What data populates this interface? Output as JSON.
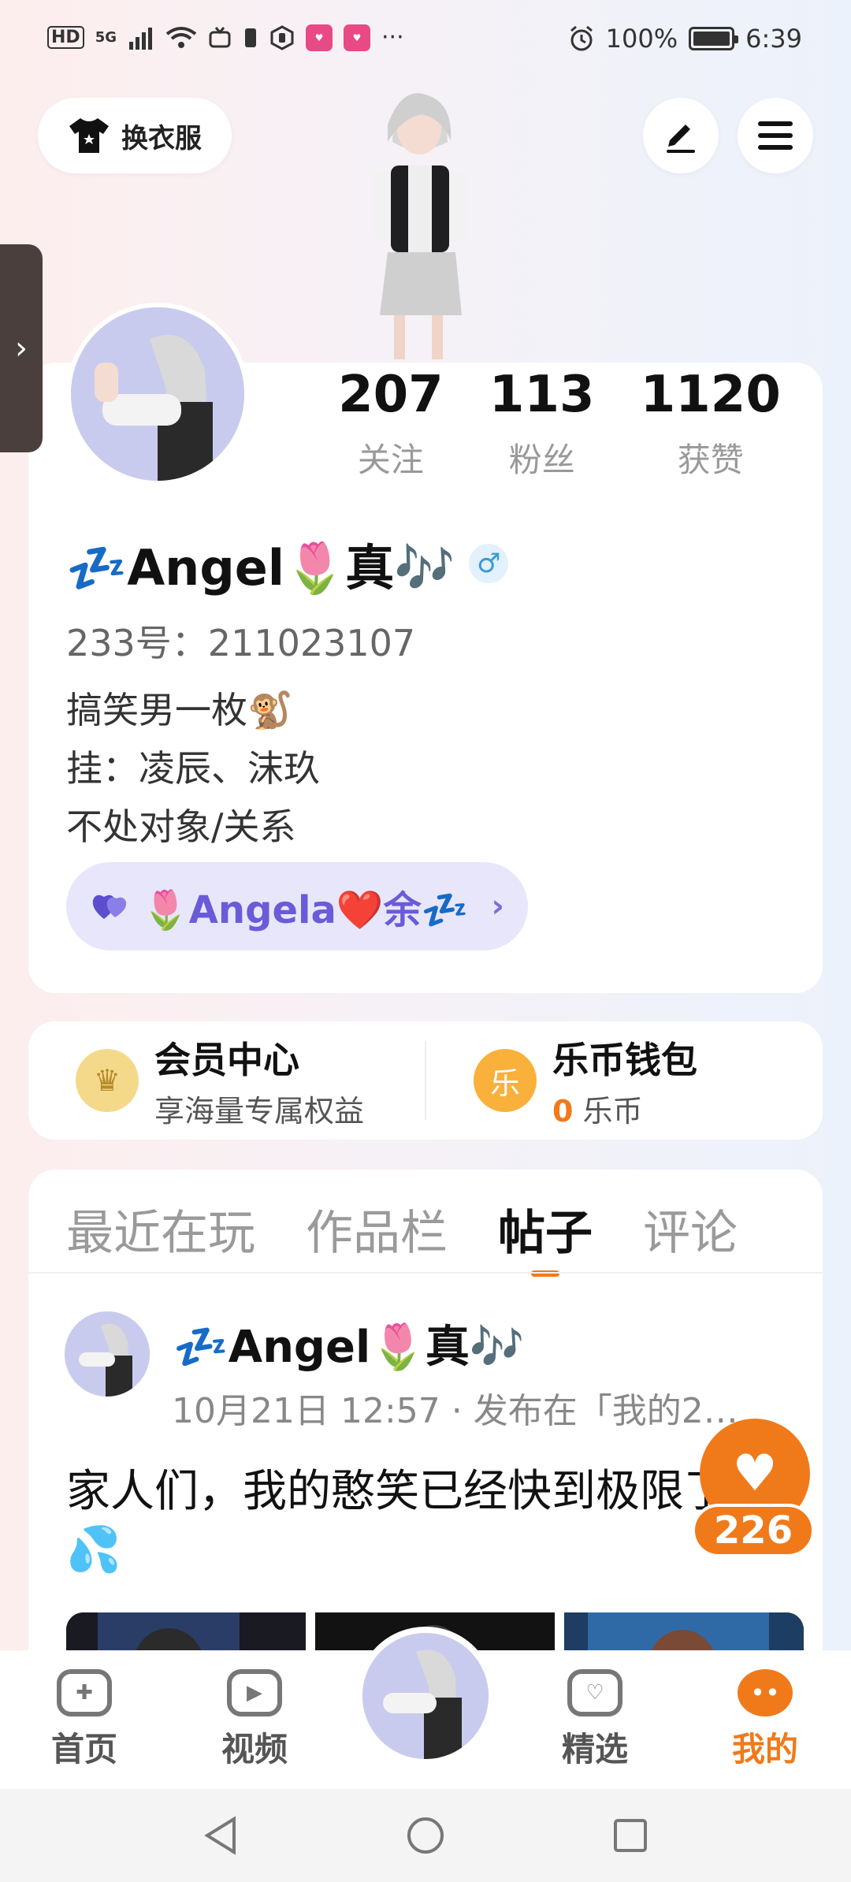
{
  "status_bar": {
    "left_label": "HD",
    "network": "5G",
    "battery": "100%",
    "battery_level": 1.0,
    "time": "6:39"
  },
  "header": {
    "outfit_button": "换衣服"
  },
  "profile": {
    "stats": [
      {
        "value": "207",
        "label": "关注"
      },
      {
        "value": "113",
        "label": "粉丝"
      },
      {
        "value": "1120",
        "label": "获赞"
      }
    ],
    "name": "💤Angel🌷真🎶",
    "gender": "♂",
    "uid": "233号：211023107",
    "bio": [
      "搞笑男一枚🐒",
      "挂：凌辰、沫玖",
      "不处对象/关系"
    ],
    "cp_label": "🌷Angela❤️余💤"
  },
  "wallet": {
    "member_title": "会员中心",
    "member_sub": "享海量专属权益",
    "coin_icon_text": "乐",
    "coin_title": "乐币钱包",
    "coin_count": "0",
    "coin_unit": "乐币"
  },
  "tabs": [
    {
      "label": "最近在玩",
      "active": false
    },
    {
      "label": "作品栏",
      "active": false
    },
    {
      "label": "帖子",
      "active": true
    },
    {
      "label": "评论",
      "active": false
    }
  ],
  "post": {
    "author": "💤Angel🌷真🎶",
    "meta": "10月21日 12:57 · 发布在「我的2…",
    "text": "家人们，我的憨笑已经快到极限了💦"
  },
  "like": {
    "count": "226"
  },
  "bottom_nav": [
    {
      "label": "首页",
      "icon": "gamepad-icon"
    },
    {
      "label": "视频",
      "icon": "video-icon"
    },
    {
      "label": "精选",
      "icon": "heart-chat-icon"
    },
    {
      "label": "我的",
      "icon": "face-icon"
    }
  ],
  "colors": {
    "accent": "#f07a1a",
    "cp_purple": "#6a5bd8"
  }
}
